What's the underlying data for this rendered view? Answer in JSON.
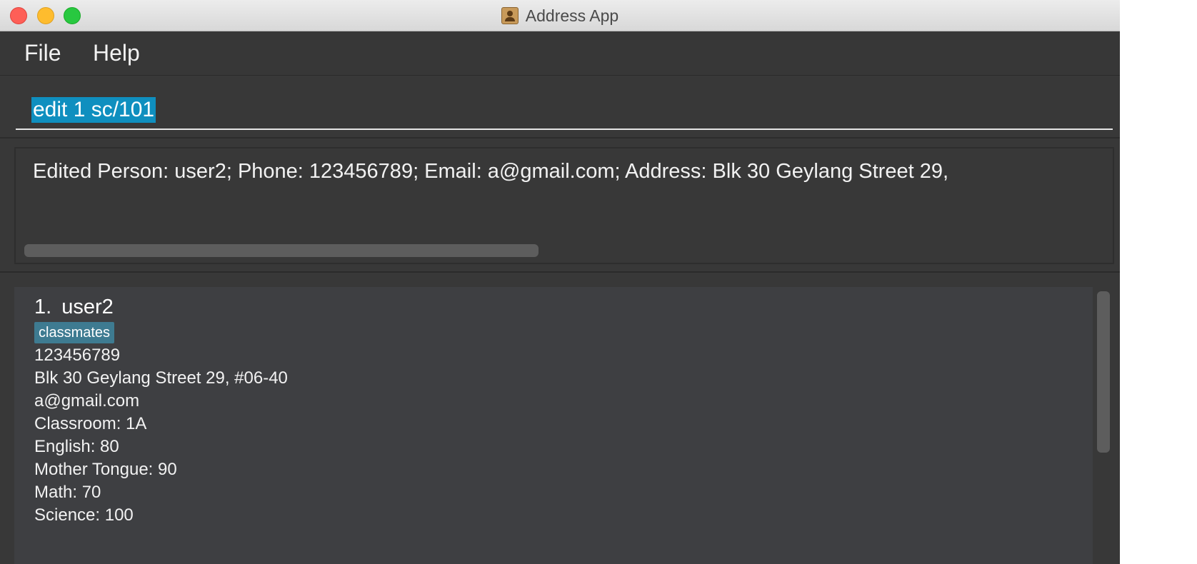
{
  "window": {
    "title": "Address App"
  },
  "menu": {
    "file": "File",
    "help": "Help"
  },
  "command": {
    "value": "edit 1 sc/101"
  },
  "result": {
    "text": "Edited Person: user2; Phone: 123456789; Email: a@gmail.com; Address: Blk 30 Geylang Street 29,"
  },
  "person": {
    "index": "1.",
    "name": "user2",
    "tag": "classmates",
    "phone": "123456789",
    "address": "Blk 30 Geylang Street 29, #06-40",
    "email": "a@gmail.com",
    "classroom": "Classroom: 1A",
    "english": "English: 80",
    "mother_tongue": "Mother Tongue: 90",
    "math": "Math: 70",
    "science": "Science: 100"
  },
  "colors": {
    "background": "#383838",
    "selection": "#0f8fbf",
    "tag": "#3e7b91",
    "card": "#3e3f42"
  }
}
